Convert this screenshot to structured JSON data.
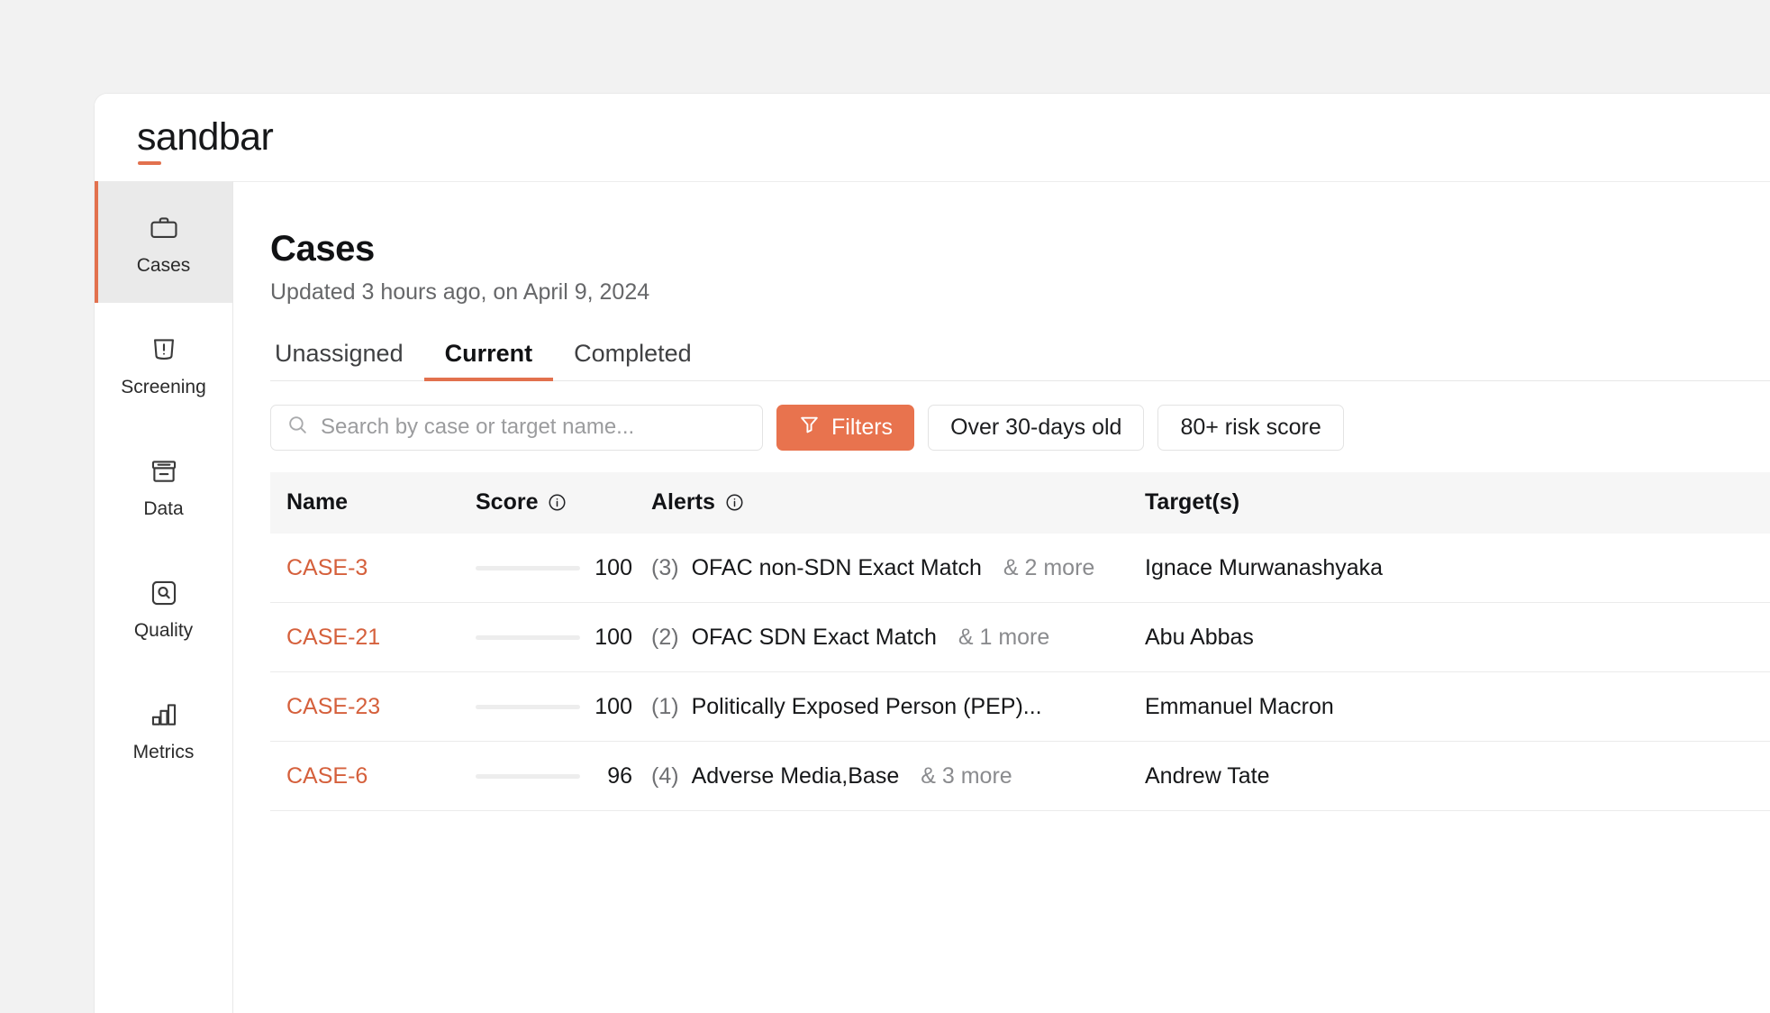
{
  "brand": {
    "name": "sandbar"
  },
  "sidebar": {
    "items": [
      {
        "label": "Cases",
        "icon": "briefcase-icon",
        "active": true
      },
      {
        "label": "Screening",
        "icon": "shield-alert-icon",
        "active": false
      },
      {
        "label": "Data",
        "icon": "archive-box-icon",
        "active": false
      },
      {
        "label": "Quality",
        "icon": "magnifier-square-icon",
        "active": false
      },
      {
        "label": "Metrics",
        "icon": "bar-chart-icon",
        "active": false
      }
    ]
  },
  "header": {
    "title": "Cases",
    "subtitle": "Updated 3 hours ago, on April 9, 2024"
  },
  "tabs": [
    {
      "label": "Unassigned",
      "active": false
    },
    {
      "label": "Current",
      "active": true
    },
    {
      "label": "Completed",
      "active": false
    }
  ],
  "toolbar": {
    "search_placeholder": "Search by case or target name...",
    "search_value": "",
    "filters_label": "Filters",
    "filter_icon": "funnel-icon",
    "chips": [
      {
        "label": "Over 30-days old"
      },
      {
        "label": "80+ risk score"
      }
    ]
  },
  "table": {
    "columns": [
      {
        "label": "Name",
        "info": false
      },
      {
        "label": "Score",
        "info": true
      },
      {
        "label": "Alerts",
        "info": true
      },
      {
        "label": "Target(s)",
        "info": false
      }
    ],
    "rows": [
      {
        "name": "CASE-3",
        "score": 100,
        "alert_count": "(3)",
        "alert_primary": "OFAC non-SDN Exact Match",
        "alert_more": "& 2 more",
        "target": "Ignace Murwanashyaka"
      },
      {
        "name": "CASE-21",
        "score": 100,
        "alert_count": "(2)",
        "alert_primary": "OFAC SDN Exact Match",
        "alert_more": "& 1 more",
        "target": "Abu Abbas"
      },
      {
        "name": "CASE-23",
        "score": 100,
        "alert_count": "(1)",
        "alert_primary": "Politically Exposed Person (PEP)...",
        "alert_more": "",
        "target": "Emmanuel Macron"
      },
      {
        "name": "CASE-6",
        "score": 96,
        "alert_count": "(4)",
        "alert_primary": "Adverse Media,Base",
        "alert_more": "& 3 more",
        "target": "Andrew Tate"
      }
    ]
  },
  "colors": {
    "accent": "#e2714e",
    "filters_button": "#e8734e",
    "case_link": "#d5603c",
    "page_background": "#f2f2f2",
    "header_row_background": "#f6f6f6"
  }
}
